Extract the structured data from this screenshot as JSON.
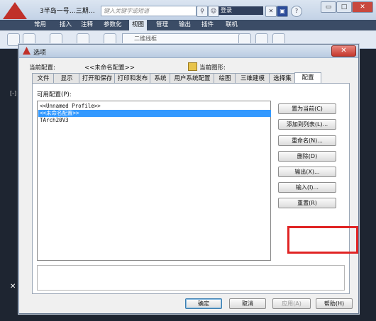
{
  "app": {
    "title": "3半岛一号…三期…",
    "search_placeholder": "键入关键字或短语",
    "login_label": "登录",
    "help_label": "?",
    "brand_color": "#c0302a"
  },
  "ribbon": {
    "tabs": [
      "常用",
      "插入",
      "注释",
      "参数化",
      "视图",
      "管理",
      "输出",
      "插件",
      "联机"
    ],
    "active_tab": "视图",
    "layer_combo": "二维线框"
  },
  "drawing": {
    "viewport_label": "[-]",
    "close_glyph": "✕"
  },
  "dialog": {
    "title": "选项",
    "close_glyph": "✕",
    "current_profile_label": "当前配置:",
    "current_profile_value": "<<未命名配置>>",
    "current_drawing_label": "当前图形:",
    "tabs": [
      "文件",
      "显示",
      "打开和保存",
      "打印和发布",
      "系统",
      "用户系统配置",
      "绘图",
      "三维建模",
      "选择集",
      "配置"
    ],
    "active_tab": "配置",
    "available_profiles_label": "可用配置(P):",
    "profiles": [
      "<<Unnamed Profile>>",
      "<<未命名配置>>",
      "TArch20V3"
    ],
    "selected_profile_index": 1,
    "side_buttons": [
      "置为当前(C)",
      "添加到列表(L)...",
      "重命名(N)...",
      "删除(D)",
      "输出(X)...",
      "输入(I)...",
      "重置(R)"
    ],
    "bottom_buttons": {
      "ok": "确定",
      "cancel": "取消",
      "apply": "应用(A)",
      "help": "帮助(H)"
    },
    "highlight_color": "#e02424"
  }
}
